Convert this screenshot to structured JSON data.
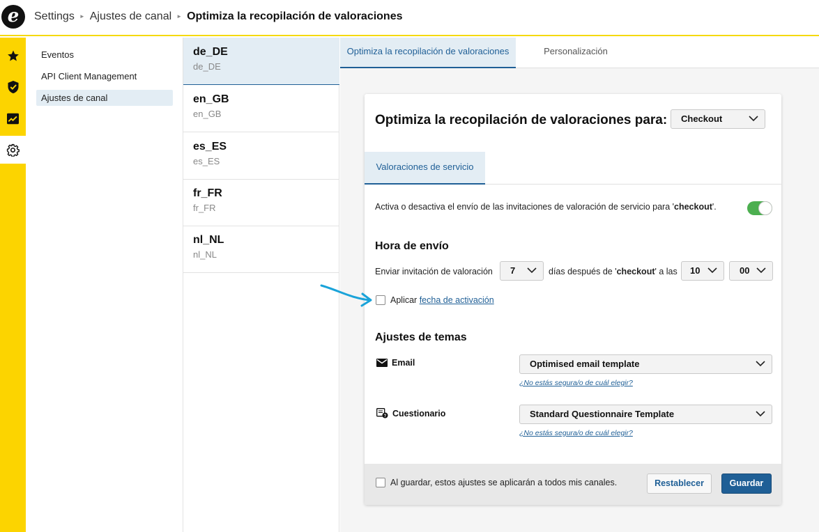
{
  "app": {
    "logo_letter": "e",
    "breadcrumb": [
      "Settings",
      "Ajustes de canal",
      "Optimiza la recopilación de valoraciones"
    ]
  },
  "rail": {
    "items": [
      {
        "icon": "star-icon"
      },
      {
        "icon": "shield-check-icon"
      },
      {
        "icon": "chart-trend-icon"
      },
      {
        "icon": "gear-icon",
        "active": true
      }
    ]
  },
  "subnav": {
    "items": [
      {
        "label": "Eventos"
      },
      {
        "label": "API Client Management"
      },
      {
        "label": "Ajustes de canal",
        "active": true
      }
    ]
  },
  "channels": [
    {
      "name": "de_DE",
      "code": "de_DE",
      "active": true
    },
    {
      "name": "en_GB",
      "code": "en_GB"
    },
    {
      "name": "es_ES",
      "code": "es_ES"
    },
    {
      "name": "fr_FR",
      "code": "fr_FR"
    },
    {
      "name": "nl_NL",
      "code": "nl_NL"
    }
  ],
  "tabs": [
    {
      "label": "Optimiza la recopilación de valoraciones",
      "active": true
    },
    {
      "label": "Personalización"
    }
  ],
  "card": {
    "title": "Optimiza la recopilación de valoraciones para:",
    "trigger_select": "Checkout",
    "inner_tab": "Valoraciones de servicio",
    "toggle": {
      "text_before": "Activa o desactiva el envío de las invitaciones de valoración de servicio para '",
      "text_bold": "checkout",
      "text_after": "'.",
      "enabled": true
    },
    "send_time": {
      "heading": "Hora de envío",
      "label": "Enviar invitación de valoración",
      "days_value": "7",
      "middle_before": "días después de '",
      "middle_bold": "checkout",
      "middle_after": "' a las",
      "hour_value": "10",
      "minute_value": "00"
    },
    "activation": {
      "text": "Aplicar",
      "link": "fecha de activación",
      "checked": false
    },
    "themes": {
      "heading": "Ajustes de temas",
      "email_label": "Email",
      "email_template": "Optimised email template",
      "email_help": "¿No estás segura/o de cuál elegir?",
      "questionnaire_label": "Cuestionario",
      "questionnaire_template": "Standard Questionnaire Template",
      "questionnaire_help": "¿No estás segura/o de cuál elegir?"
    },
    "footer": {
      "apply_all_text": "Al guardar, estos ajustes se aplicarán a todos mis canales.",
      "apply_all_checked": false,
      "reset_label": "Restablecer",
      "save_label": "Guardar"
    }
  },
  "colors": {
    "accent_yellow": "#fcd400",
    "primary_blue": "#1f5f96",
    "selected_bg": "#e3edf4",
    "toggle_green": "#4caf50",
    "annotation_arrow": "#1aa3d9"
  }
}
